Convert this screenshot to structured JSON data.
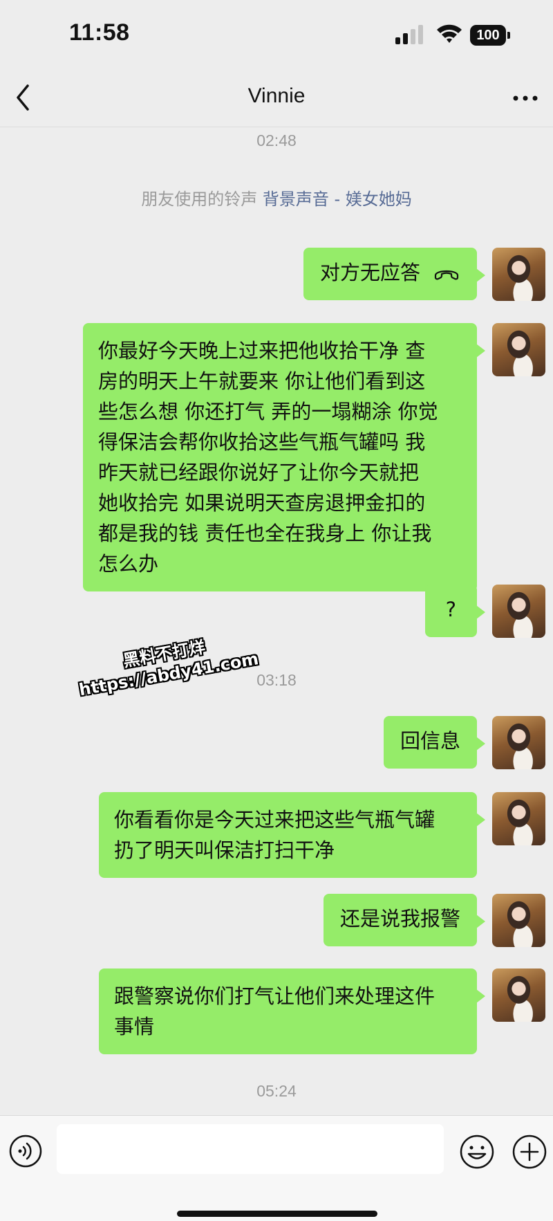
{
  "status_bar": {
    "time": "11:58",
    "battery": "100"
  },
  "header": {
    "title": "Vinnie"
  },
  "timestamps": [
    "02:48",
    "03:18",
    "05:24"
  ],
  "system_message": {
    "prefix": "朋友使用的铃声",
    "link": "背景声音 - 媄女她妈"
  },
  "messages": [
    {
      "text": "对方无应答",
      "icon": "phone-hangup-icon"
    },
    {
      "text": "你最好今天晚上过来把他收拾干净 查\n房的明天上午就要来 你让他们看到这\n些怎么想 你还打气 弄的一塌糊涂 你觉\n得保洁会帮你收拾这些气瓶气罐吗 我\n昨天就已经跟你说好了让你今天就把\n她收拾完 如果说明天查房退押金扣的\n都是我的钱 责任也全在我身上 你让我\n怎么办"
    },
    {
      "text": "?"
    },
    {
      "text": "回信息"
    },
    {
      "text": "你看看你是今天过来把这些气瓶气罐\n扔了明天叫保洁打扫干净"
    },
    {
      "text": "还是说我报警"
    },
    {
      "text": "跟警察说你们打气让他们来处理这件\n事情"
    }
  ],
  "watermark": {
    "line1": "黑料不打烊",
    "line2": "https://abdy41.com"
  },
  "input": {
    "value": ""
  }
}
